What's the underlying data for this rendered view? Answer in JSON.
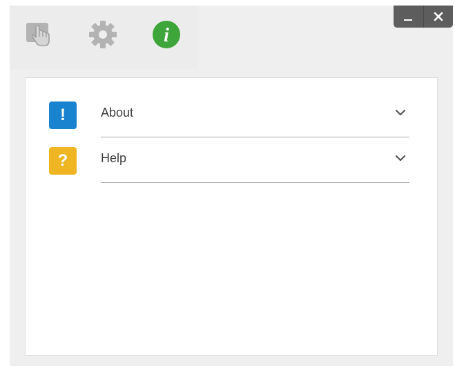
{
  "toolbar": {
    "icons": [
      {
        "name": "touch-hand-icon",
        "color": "#b0b0b0"
      },
      {
        "name": "gear-icon",
        "color": "#b0b0b0"
      },
      {
        "name": "info-icon",
        "color": "#3ea53a",
        "glyph": "i",
        "active": true
      }
    ]
  },
  "window_controls": {
    "minimize_icon": "minimize-icon",
    "close_icon": "close-icon",
    "close_glyph": "✕",
    "background": "#5d5d5d"
  },
  "panel": {
    "items": [
      {
        "label": "About",
        "badge": "!",
        "badge_color": "#1a83d0",
        "icon": "chevron-down-icon"
      },
      {
        "label": "Help",
        "badge": "?",
        "badge_color": "#f0b523",
        "icon": "chevron-down-icon"
      }
    ]
  }
}
